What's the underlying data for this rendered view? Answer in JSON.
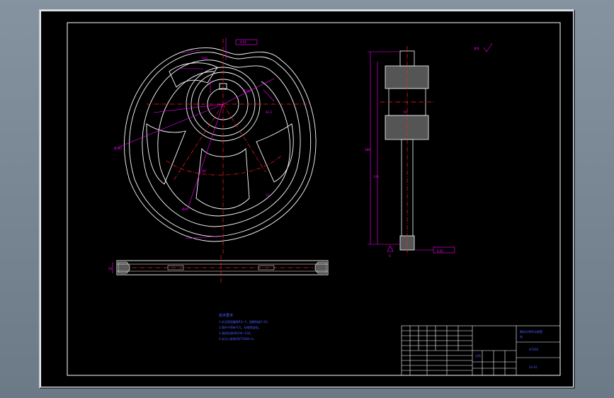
{
  "colors": {
    "background": "#000000",
    "frame": "#ffffff",
    "geometry": "#ffffff",
    "dimension": "#ff00ff",
    "centerline": "#ff2020",
    "text": "#4a5cff",
    "viewport_border": "#c8ced4"
  },
  "notes": {
    "heading": "技术要求",
    "lines": [
      "1.未注铸造圆角R3~5，拔模斜度1:20。",
      "2.铸件不得有气孔、砂眼等缺陷。",
      "3.调质处理HB200~230。",
      "4.未注公差按GB/T1804-m。"
    ]
  },
  "roughness_mark": "其余",
  "datum_label": "A",
  "title_block": {
    "title": "蜗轮车带传动装置",
    "title2": "轮",
    "scale_label": "比例",
    "material": "HT200",
    "drawing_no": "LD-01"
  },
  "dimensions": {
    "d_outer": "Ø280",
    "d_hub": "Ø100",
    "d_bore": "Ø40",
    "r_arm": "R10",
    "width": "50",
    "hub_width": "70",
    "keyway": "12",
    "keyway_depth": "43.3",
    "height_total": "280",
    "height_half": "140",
    "tol_box": "0.03",
    "angle": "30°"
  }
}
